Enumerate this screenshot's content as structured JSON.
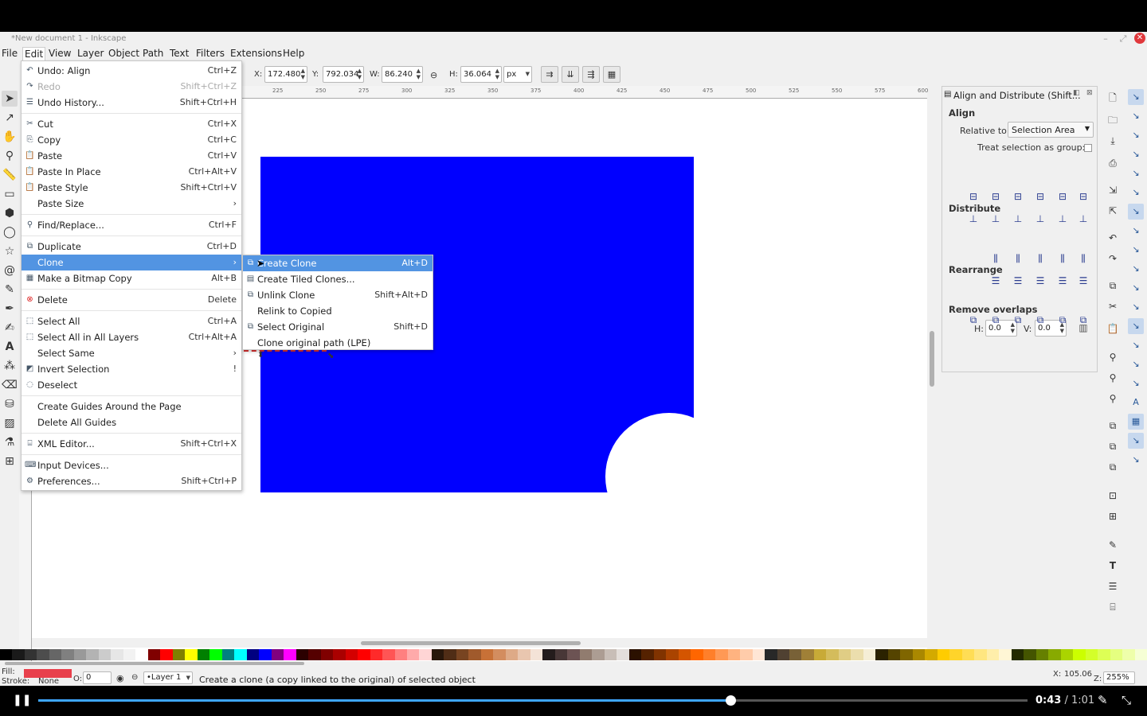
{
  "window": {
    "title": "*New document 1 - Inkscape"
  },
  "menubar": [
    "File",
    "Edit",
    "View",
    "Layer",
    "Object",
    "Path",
    "Text",
    "Filters",
    "Extensions",
    "Help"
  ],
  "toolbar": {
    "x_label": "X:",
    "x_value": "172.480",
    "y_label": "Y:",
    "y_value": "792.034",
    "w_label": "W:",
    "w_value": "86.240",
    "h_label": "H:",
    "h_value": "36.064",
    "unit": "px"
  },
  "ruler_ticks": [
    "225",
    "250",
    "275",
    "300",
    "325",
    "350",
    "375",
    "400",
    "425",
    "450",
    "475",
    "500",
    "525",
    "550",
    "575",
    "600"
  ],
  "edit_menu": [
    {
      "label": "Undo: Align",
      "shortcut": "Ctrl+Z",
      "icon": "undo-icon"
    },
    {
      "label": "Redo",
      "shortcut": "Shift+Ctrl+Z",
      "icon": "redo-icon",
      "disabled": true
    },
    {
      "label": "Undo History...",
      "shortcut": "Shift+Ctrl+H",
      "icon": "history-icon"
    },
    {
      "label": "Cut",
      "shortcut": "Ctrl+X",
      "icon": "cut-icon"
    },
    {
      "label": "Copy",
      "shortcut": "Ctrl+C",
      "icon": "copy-icon"
    },
    {
      "label": "Paste",
      "shortcut": "Ctrl+V",
      "icon": "paste-icon"
    },
    {
      "label": "Paste In Place",
      "shortcut": "Ctrl+Alt+V",
      "icon": "paste-in-place-icon"
    },
    {
      "label": "Paste Style",
      "shortcut": "Shift+Ctrl+V",
      "icon": "paste-style-icon"
    },
    {
      "label": "Paste Size",
      "shortcut": "›",
      "icon": ""
    },
    {
      "label": "Find/Replace...",
      "shortcut": "Ctrl+F",
      "icon": "find-icon"
    },
    {
      "label": "Duplicate",
      "shortcut": "Ctrl+D",
      "icon": "duplicate-icon"
    },
    {
      "label": "Clone",
      "shortcut": "›",
      "icon": ""
    },
    {
      "label": "Make a Bitmap Copy",
      "shortcut": "Alt+B",
      "icon": "bitmap-icon"
    },
    {
      "label": "Delete",
      "shortcut": "Delete",
      "icon": "delete-icon"
    },
    {
      "label": "Select All",
      "shortcut": "Ctrl+A",
      "icon": "select-all-icon"
    },
    {
      "label": "Select All in All Layers",
      "shortcut": "Ctrl+Alt+A",
      "icon": "select-all-layers-icon"
    },
    {
      "label": "Select Same",
      "shortcut": "›",
      "icon": ""
    },
    {
      "label": "Invert Selection",
      "shortcut": "!",
      "icon": "invert-selection-icon"
    },
    {
      "label": "Deselect",
      "shortcut": "",
      "icon": "deselect-icon"
    },
    {
      "label": "Create Guides Around the Page",
      "shortcut": "",
      "icon": ""
    },
    {
      "label": "Delete All Guides",
      "shortcut": "",
      "icon": ""
    },
    {
      "label": "XML Editor...",
      "shortcut": "Shift+Ctrl+X",
      "icon": "xml-icon"
    },
    {
      "label": "Input Devices...",
      "shortcut": "",
      "icon": "input-devices-icon"
    },
    {
      "label": "Preferences...",
      "shortcut": "Shift+Ctrl+P",
      "icon": "preferences-icon"
    }
  ],
  "clone_submenu": [
    {
      "label": "Create Clone",
      "shortcut": "Alt+D",
      "icon": "clone-icon"
    },
    {
      "label": "Create Tiled Clones...",
      "shortcut": "",
      "icon": "tiled-clones-icon"
    },
    {
      "label": "Unlink Clone",
      "shortcut": "Shift+Alt+D",
      "icon": "unlink-clone-icon"
    },
    {
      "label": "Relink to Copied",
      "shortcut": "",
      "icon": ""
    },
    {
      "label": "Select Original",
      "shortcut": "Shift+D",
      "icon": "select-original-icon"
    },
    {
      "label": "Clone original path (LPE)",
      "shortcut": "",
      "icon": ""
    }
  ],
  "panel": {
    "title": "Align and Distribute (Shift...",
    "align_heading": "Align",
    "relative_label": "Relative to:",
    "relative_value": "Selection Area",
    "group_label": "Treat selection as group:",
    "distribute_heading": "Distribute",
    "rearrange_heading": "Rearrange",
    "overlaps_heading": "Remove overlaps",
    "h_label": "H:",
    "h_value": "0.0",
    "v_label": "V:",
    "v_value": "0.0"
  },
  "status": {
    "fill_label": "Fill:",
    "stroke_label": "Stroke:",
    "stroke_value": "None",
    "opacity_label": "O:",
    "opacity_value": "0",
    "layer": "•Layer 1",
    "message": "Create a clone (a copy linked to the original) of selected object",
    "x_label": "X:",
    "x_value": "105.06",
    "zoom_label": "Z:",
    "zoom_value": "255%",
    "fill_color": "#e8404c"
  },
  "player": {
    "current": "0:43",
    "separator": " / ",
    "total": "1:01",
    "progress": 0.7
  },
  "palette": [
    "#000000",
    "#1a1a1a",
    "#333333",
    "#4d4d4d",
    "#666666",
    "#808080",
    "#999999",
    "#b3b3b3",
    "#cccccc",
    "#e6e6e6",
    "#f2f2f2",
    "#ffffff",
    "#800000",
    "#ff0000",
    "#808000",
    "#ffff00",
    "#008000",
    "#00ff00",
    "#008080",
    "#00ffff",
    "#000080",
    "#0000ff",
    "#800080",
    "#ff00ff",
    "#2b0000",
    "#550000",
    "#800000",
    "#aa0000",
    "#d40000",
    "#ff0000",
    "#ff2a2a",
    "#ff5555",
    "#ff8080",
    "#ffaaaa",
    "#ffd5d5",
    "#28170b",
    "#502d16",
    "#784421",
    "#a05a2c",
    "#c87137",
    "#d38d5f",
    "#deaa87",
    "#e9c6af",
    "#f4e3d7",
    "#241c1c",
    "#483737",
    "#6c5353",
    "#917c6f",
    "#ac9d93",
    "#c8beb7",
    "#e3dedb",
    "#2b1100",
    "#552200",
    "#803300",
    "#aa4400",
    "#d45500",
    "#ff6600",
    "#ff7f2a",
    "#ff9955",
    "#ffb380",
    "#ffccaa",
    "#ffe6d5",
    "#282828",
    "#504132",
    "#786137",
    "#a08037",
    "#c8aa37",
    "#d4bc5c",
    "#e0cd85",
    "#ebdead",
    "#f5eed6",
    "#2b2200",
    "#554400",
    "#806600",
    "#aa8800",
    "#d4aa00",
    "#ffcc00",
    "#ffd42a",
    "#ffdd55",
    "#ffe680",
    "#ffeeaa",
    "#fff6d5",
    "#222b00",
    "#445500",
    "#668000",
    "#88aa00",
    "#aad400",
    "#ccff00",
    "#d4ff2a",
    "#ddff55",
    "#e5ff80",
    "#eeffaa",
    "#f6ffd5"
  ]
}
